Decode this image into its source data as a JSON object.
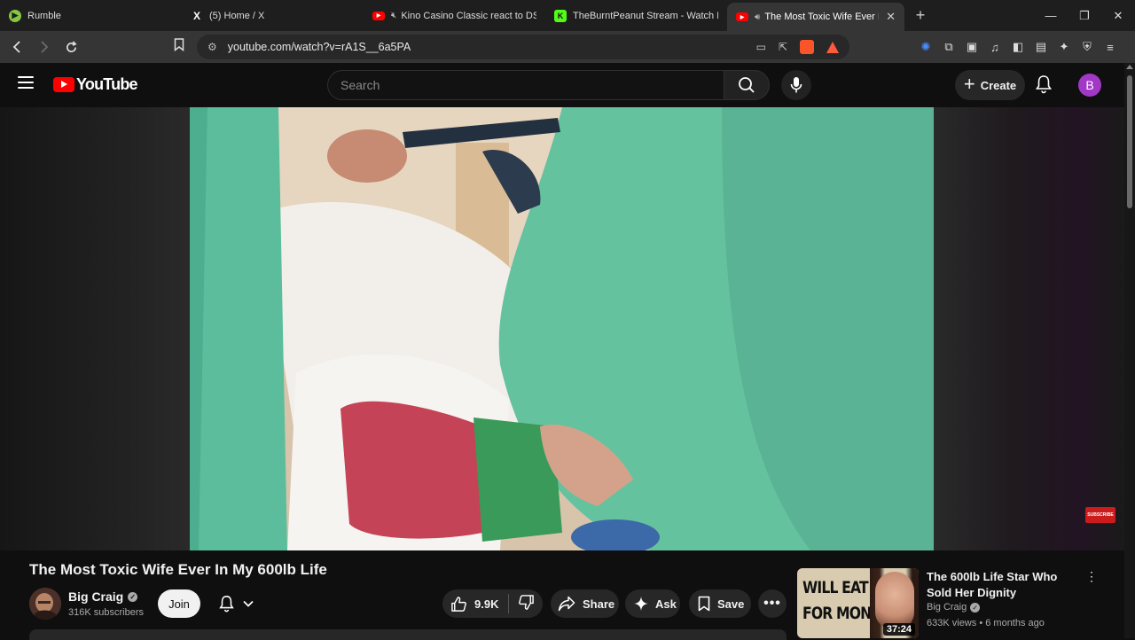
{
  "browser": {
    "tabs": [
      {
        "title": "Rumble",
        "favicon": "rumble-icon",
        "color": "#85c742",
        "active": false
      },
      {
        "title": "(5) Home / X",
        "favicon": "x-icon",
        "color": "#ffffff",
        "active": false
      },
      {
        "title": "Kino Casino Classic react to DSPG",
        "favicon": "youtube-icon",
        "color": "#ff0000",
        "active": false,
        "muted": true
      },
      {
        "title": "TheBurntPeanut Stream - Watch Live",
        "favicon": "kick-icon",
        "color": "#53fc18",
        "active": false
      },
      {
        "title": "The Most Toxic Wife Ever In My",
        "favicon": "youtube-icon",
        "color": "#ff0000",
        "active": true,
        "audio": true
      }
    ],
    "url": "youtube.com/watch?v=rA1S__6a5PA"
  },
  "youtube": {
    "logo_text": "YouTube",
    "search_placeholder": "Search",
    "create_label": "Create",
    "account_initial": "B",
    "account_color": "#a238c6"
  },
  "video": {
    "title": "The Most Toxic Wife Ever In My 600lb Life",
    "watermark": "SUBSCRIBE"
  },
  "channel": {
    "name": "Big Craig",
    "subscribers": "316K subscribers",
    "join_label": "Join"
  },
  "actions": {
    "likes": "9.9K",
    "share": "Share",
    "ask": "Ask",
    "save": "Save"
  },
  "recommendation": {
    "thumb_line1": "WILL EAT",
    "thumb_line2": "FOR MONEY",
    "duration": "37:24",
    "title": "The 600lb Life Star Who Sold Her Dignity",
    "channel": "Big Craig",
    "views": "633K views",
    "age": "6 months ago",
    "meta_sep": " • "
  }
}
